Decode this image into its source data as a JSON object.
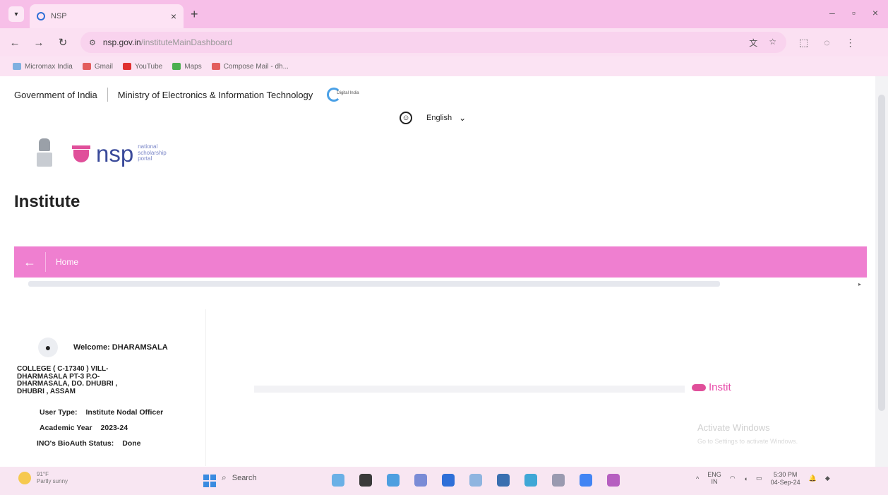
{
  "browser": {
    "tab_title": "NSP",
    "url_host": "nsp.gov.in",
    "url_path": "/instituteMainDashboard",
    "bookmarks": [
      "Micromax India",
      "Gmail",
      "YouTube",
      "Maps",
      "Compose Mail - dh..."
    ]
  },
  "header": {
    "gov_label": "Government of India",
    "ministry_label": "Ministry of Electronics & Information Technology",
    "digital_india_label": "Digital India",
    "language": "English"
  },
  "brand": {
    "name": "nsp",
    "tagline_1": "national",
    "tagline_2": "scholarship",
    "tagline_3": "portal"
  },
  "page": {
    "heading": "Institute",
    "breadcrumb_home": "Home"
  },
  "user": {
    "welcome": "Welcome: DHARAMSALA",
    "welcome_cont": "COLLEGE ( C-17340 ) VILL-\nDHARMASALA PT-3 P.O-\nDHARMASALA, DO. DHUBRI ,\nDHUBRI , ASSAM",
    "user_type_label": "User Type:",
    "user_type_value": "Institute Nodal Officer",
    "academic_year_label": "Academic Year",
    "academic_year_value": "2023-24",
    "bioauth_label": "INO's BioAuth Status:",
    "bioauth_value": "Done"
  },
  "badge": {
    "label": "Instit"
  },
  "watermark": {
    "title": "Activate Windows",
    "subtitle": "Go to Settings to activate Windows."
  },
  "taskbar": {
    "temperature": "91°F",
    "weather": "Partly sunny",
    "search": "Search",
    "lang_1": "ENG",
    "lang_2": "IN",
    "time": "5:30 PM",
    "date": "04-Sep-24"
  },
  "colors": {
    "brand_pink": "#ef7fd0",
    "brand_blue": "#3a4a9a"
  }
}
